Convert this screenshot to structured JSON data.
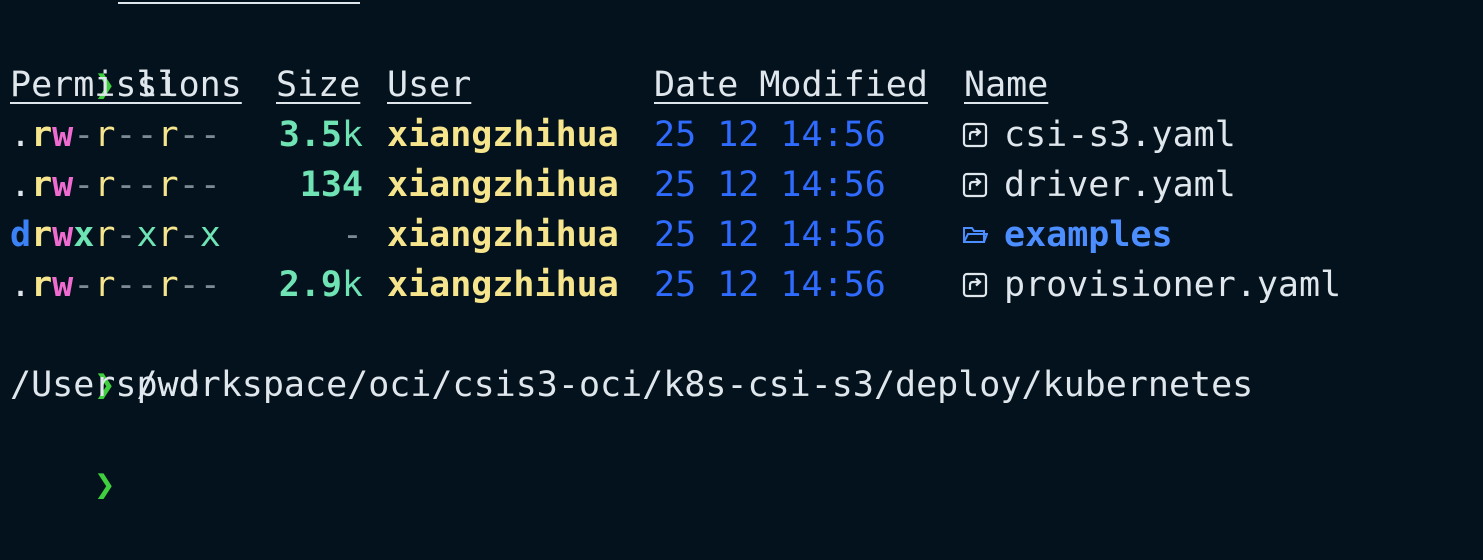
{
  "colors": {
    "background": "#03121d",
    "prompt": "#3fcf3f",
    "user": "#f6e58d",
    "date": "#2f6bff",
    "directory": "#4c8dff",
    "size": "#6fe3b3",
    "write": "#f06bd0"
  },
  "commands": {
    "ll": {
      "prompt": "❯",
      "text": "ll"
    },
    "pwd": {
      "prompt": "❯",
      "text": "pwd"
    },
    "next": {
      "prompt": "❯"
    }
  },
  "headers": {
    "permissions": "Permissions",
    "size": "Size",
    "user": "User",
    "date": "Date Modified",
    "name": "Name"
  },
  "rows": [
    {
      "perm": {
        "type": ".",
        "u_r": "r",
        "u_w": "w",
        "u_x": "-",
        "g_r": "r",
        "g_w": "-",
        "g_x": "-",
        "o_r": "r",
        "o_w": "-",
        "o_x": "-"
      },
      "size_num": "3.5",
      "size_unit": "k",
      "user": "xiangzhihua",
      "date": "25 12 14:56",
      "icon": "file-link-icon",
      "name": "csi-s3.yaml",
      "is_dir": false
    },
    {
      "perm": {
        "type": ".",
        "u_r": "r",
        "u_w": "w",
        "u_x": "-",
        "g_r": "r",
        "g_w": "-",
        "g_x": "-",
        "o_r": "r",
        "o_w": "-",
        "o_x": "-"
      },
      "size_num": "134",
      "size_unit": "",
      "user": "xiangzhihua",
      "date": "25 12 14:56",
      "icon": "file-link-icon",
      "name": "driver.yaml",
      "is_dir": false
    },
    {
      "perm": {
        "type": "d",
        "u_r": "r",
        "u_w": "w",
        "u_x": "x",
        "g_r": "r",
        "g_w": "-",
        "g_x": "x",
        "o_r": "r",
        "o_w": "-",
        "o_x": "x"
      },
      "size_num": "-",
      "size_unit": "",
      "user": "xiangzhihua",
      "date": "25 12 14:56",
      "icon": "folder-icon",
      "name": "examples",
      "is_dir": true
    },
    {
      "perm": {
        "type": ".",
        "u_r": "r",
        "u_w": "w",
        "u_x": "-",
        "g_r": "r",
        "g_w": "-",
        "g_x": "-",
        "o_r": "r",
        "o_w": "-",
        "o_x": "-"
      },
      "size_num": "2.9",
      "size_unit": "k",
      "user": "xiangzhihua",
      "date": "25 12 14:56",
      "icon": "file-link-icon",
      "name": "provisioner.yaml",
      "is_dir": false
    }
  ],
  "pwd_output": "/Users/workspace/oci/csis3-oci/k8s-csi-s3/deploy/kubernetes"
}
